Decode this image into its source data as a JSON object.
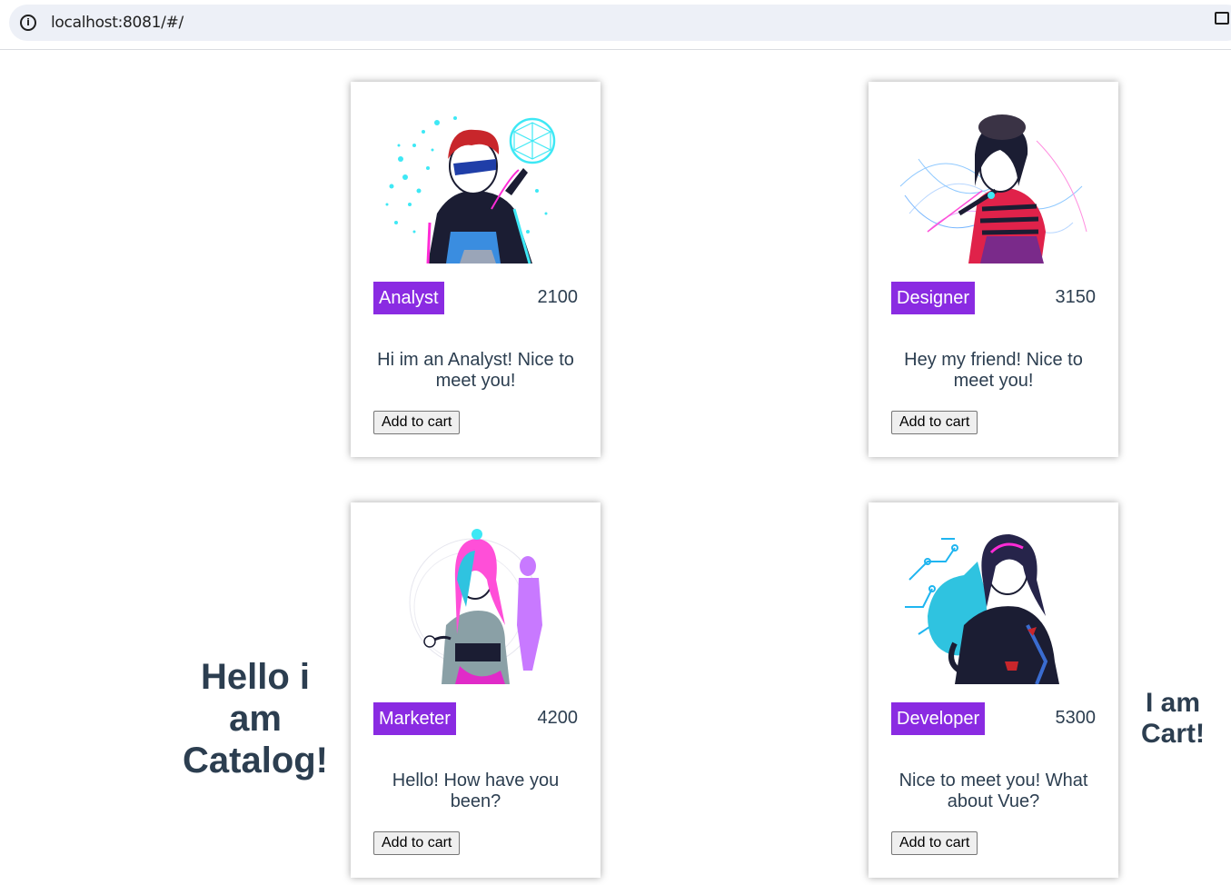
{
  "browser": {
    "url": "localhost:8081/#/"
  },
  "catalog": {
    "heading": "Hello i am Catalog!",
    "products": [
      {
        "role": "Analyst",
        "price": "2100",
        "description": "Hi im an Analyst! Nice to meet you!",
        "button_label": "Add to cart"
      },
      {
        "role": "Designer",
        "price": "3150",
        "description": "Hey my friend! Nice to meet you!",
        "button_label": "Add to cart"
      },
      {
        "role": "Marketer",
        "price": "4200",
        "description": "Hello! How have you been?",
        "button_label": "Add to cart"
      },
      {
        "role": "Developer",
        "price": "5300",
        "description": "Nice to meet you! What about Vue?",
        "button_label": "Add to cart"
      }
    ]
  },
  "cart": {
    "heading": "I am Cart!"
  },
  "colors": {
    "badge": "#8a2be2",
    "text": "#2c3e50"
  }
}
